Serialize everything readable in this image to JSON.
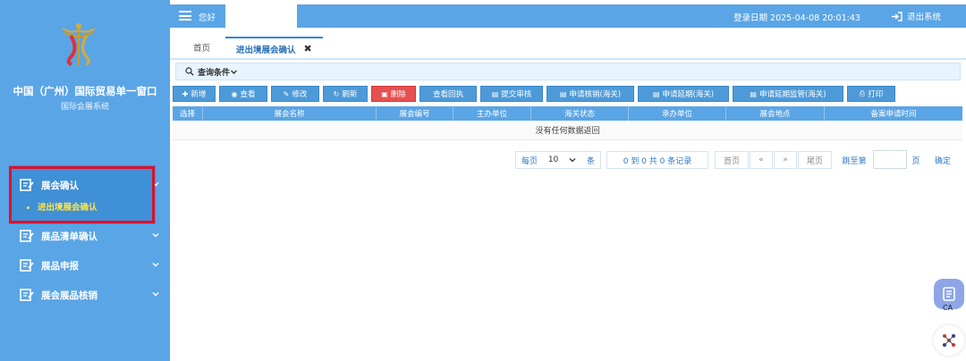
{
  "sidebar": {
    "system_name": "中国（广州）国际贸易单一窗口",
    "system_sub": "国际会展系统",
    "groups": [
      {
        "label": "展会确认",
        "icon": "edit-icon",
        "expanded": true,
        "items": [
          {
            "label": "进出境展会确认"
          }
        ]
      },
      {
        "label": "展品清单确认",
        "icon": "edit-icon"
      },
      {
        "label": "展品申报",
        "icon": "edit-icon"
      },
      {
        "label": "展会展品核销",
        "icon": "edit-icon"
      }
    ]
  },
  "header": {
    "greeting": "您好",
    "login_info": "登录日期 2025-04-08 20:01:43",
    "logout": "退出系统"
  },
  "tabs": [
    {
      "label": "首页"
    },
    {
      "label": "进出境展会确认",
      "close": "✖"
    }
  ],
  "search": {
    "label": "查询条件"
  },
  "toolbar": [
    {
      "label": "新增",
      "icon": "plus-icon"
    },
    {
      "label": "查看",
      "icon": "eye-icon"
    },
    {
      "label": "修改",
      "icon": "edit-icon"
    },
    {
      "label": "刷新",
      "icon": "refresh-icon"
    },
    {
      "label": "删除",
      "icon": "trash-icon"
    },
    {
      "label": "查看回执",
      "icon": ""
    },
    {
      "label": "提交审核",
      "icon": "card-icon"
    },
    {
      "label": "申请核销(海关)",
      "icon": "card-icon"
    },
    {
      "label": "申请延期(海关)",
      "icon": "card-icon"
    },
    {
      "label": "申请延期监管(海关)",
      "icon": "card-icon"
    },
    {
      "label": "打印",
      "icon": "print-icon"
    }
  ],
  "table": {
    "columns": [
      "选择",
      "展会名称",
      "展会编号",
      "主办单位",
      "海关状态",
      "承办单位",
      "展会地点",
      "备案申请时间"
    ],
    "empty_text": "没有任何数据返回"
  },
  "pagination": {
    "per_page_label": "每页",
    "per_page_value": "10",
    "per_page_unit": "条",
    "records_text": "0 到 0 共 0 条记录",
    "first": "首页",
    "prev": "«",
    "next": "»",
    "last": "尾页",
    "jump_label": "跳至第",
    "page_unit": "页",
    "confirm": "确定"
  },
  "floating": {
    "ca_label": "CA"
  },
  "colors": {
    "primary": "#5aa5e6",
    "highlight": "#ffe34a",
    "danger": "#e55050",
    "outline": "#e0102a"
  }
}
